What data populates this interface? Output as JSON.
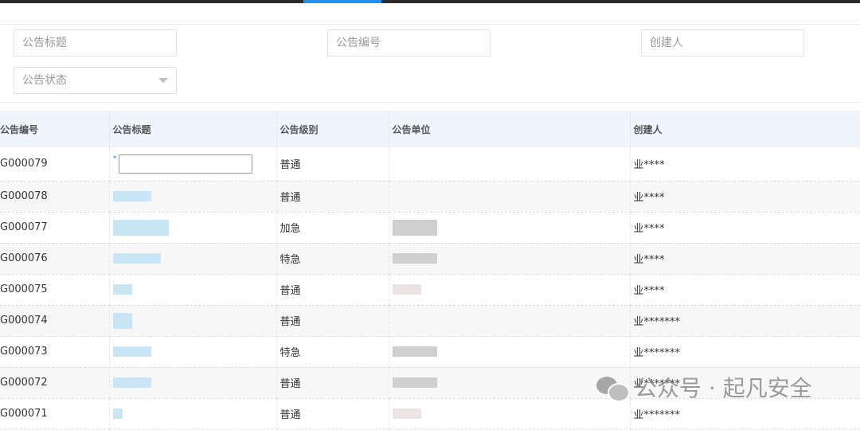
{
  "filters": {
    "title_placeholder": "公告标题",
    "number_placeholder": "公告编号",
    "creator_placeholder": "创建人",
    "status_placeholder": "公告状态"
  },
  "table": {
    "headers": [
      "公告编号",
      "公告标题",
      "公告级别",
      "公告单位",
      "创建人"
    ],
    "rows": [
      {
        "number": "G000079",
        "level": "普通",
        "creator": "业****"
      },
      {
        "number": "G000078",
        "level": "普通",
        "creator": "业****"
      },
      {
        "number": "G000077",
        "level": "加急",
        "creator": "业****"
      },
      {
        "number": "G000076",
        "level": "特急",
        "creator": "业****"
      },
      {
        "number": "G000075",
        "level": "普通",
        "creator": "业****"
      },
      {
        "number": "G000074",
        "level": "普通",
        "creator": "业*******"
      },
      {
        "number": "G000073",
        "level": "特急",
        "creator": "业*******"
      },
      {
        "number": "G000072",
        "level": "普通",
        "creator": "业*******"
      },
      {
        "number": "G000071",
        "level": "普通",
        "creator": "业*******"
      }
    ]
  },
  "watermark": {
    "text": "公众号 · 起凡安全",
    "icon": "wechat-icon"
  },
  "colors": {
    "accent": "#2d8cf0",
    "header_bg": "#eef5fd",
    "topbar": "#2b2b2b"
  }
}
